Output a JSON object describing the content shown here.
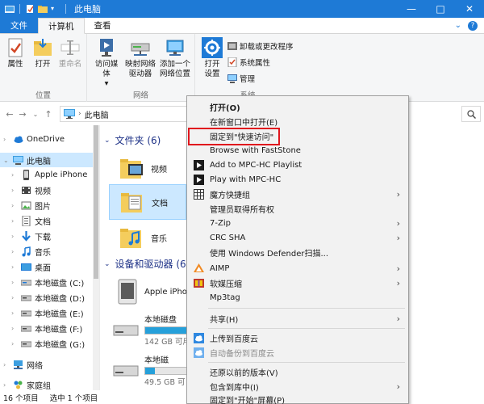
{
  "window": {
    "title": "此电脑",
    "controls": [
      "—",
      "□",
      "✕"
    ]
  },
  "tabs": {
    "file": "文件",
    "computer": "计算机",
    "view": "查看"
  },
  "ribbon": {
    "location_group": "位置",
    "network_group": "网络",
    "system_group": "系统",
    "properties": "属性",
    "open": "打开",
    "rename": "重命名",
    "access_media_line1": "访问媒体",
    "map_drive_line1": "映射网络",
    "map_drive_line2": "驱动器",
    "add_location_line1": "添加一个",
    "add_location_line2": "网络位置",
    "open_settings_line1": "打开",
    "open_settings_line2": "设置",
    "uninstall": "卸载或更改程序",
    "sys_props": "系统属性",
    "manage": "管理"
  },
  "address": {
    "path": "此电脑"
  },
  "nav": {
    "onedrive": "OneDrive",
    "this_pc": "此电脑",
    "iphone": "Apple iPhone",
    "videos": "视频",
    "pictures": "图片",
    "documents": "文档",
    "downloads": "下载",
    "music": "音乐",
    "desktop": "桌面",
    "disk_c": "本地磁盘 (C:)",
    "disk_d": "本地磁盘 (D:)",
    "disk_e": "本地磁盘 (E:)",
    "disk_f": "本地磁盘 (F:)",
    "disk_g": "本地磁盘 (G:)",
    "network": "网络",
    "homegroup": "家庭组"
  },
  "content": {
    "folders_header": "文件夹 (6)",
    "devices_header": "设备和驱动器 (6",
    "folder_videos": "视频",
    "folder_documents": "文档",
    "folder_music": "音乐",
    "device_iphone": "Apple iPho",
    "drive1_name": "本地磁盘",
    "drive1_size": "142 GB 可用",
    "drive1_used_fraction": 0.62,
    "drive2_name": "本地磁",
    "drive2_size": "49.5 GB 可",
    "drive2_used_fraction": 0.1
  },
  "status": {
    "count": "16 个项目",
    "selected": "选中 1 个项目"
  },
  "context_menu": {
    "items": [
      "打开(O)",
      "在新窗口中打开(E)",
      "固定到\"快速访问\"",
      "Browse with FastStone",
      "Add to MPC-HC Playlist",
      "Play with MPC-HC",
      "魔方快捷组",
      "管理员取得所有权",
      "7-Zip",
      "CRC SHA",
      "使用 Windows Defender扫描...",
      "AIMP",
      "软媒压缩",
      "Mp3tag",
      "共享(H)",
      "上传到百度云",
      "自动备份到百度云",
      "还原以前的版本(V)",
      "包含到库中(I)",
      "固定到\"开始\"屏幕(P)"
    ]
  },
  "colors": {
    "accent": "#1e7ad6",
    "selection": "#cce8ff",
    "highlight_box": "#e0161d"
  }
}
